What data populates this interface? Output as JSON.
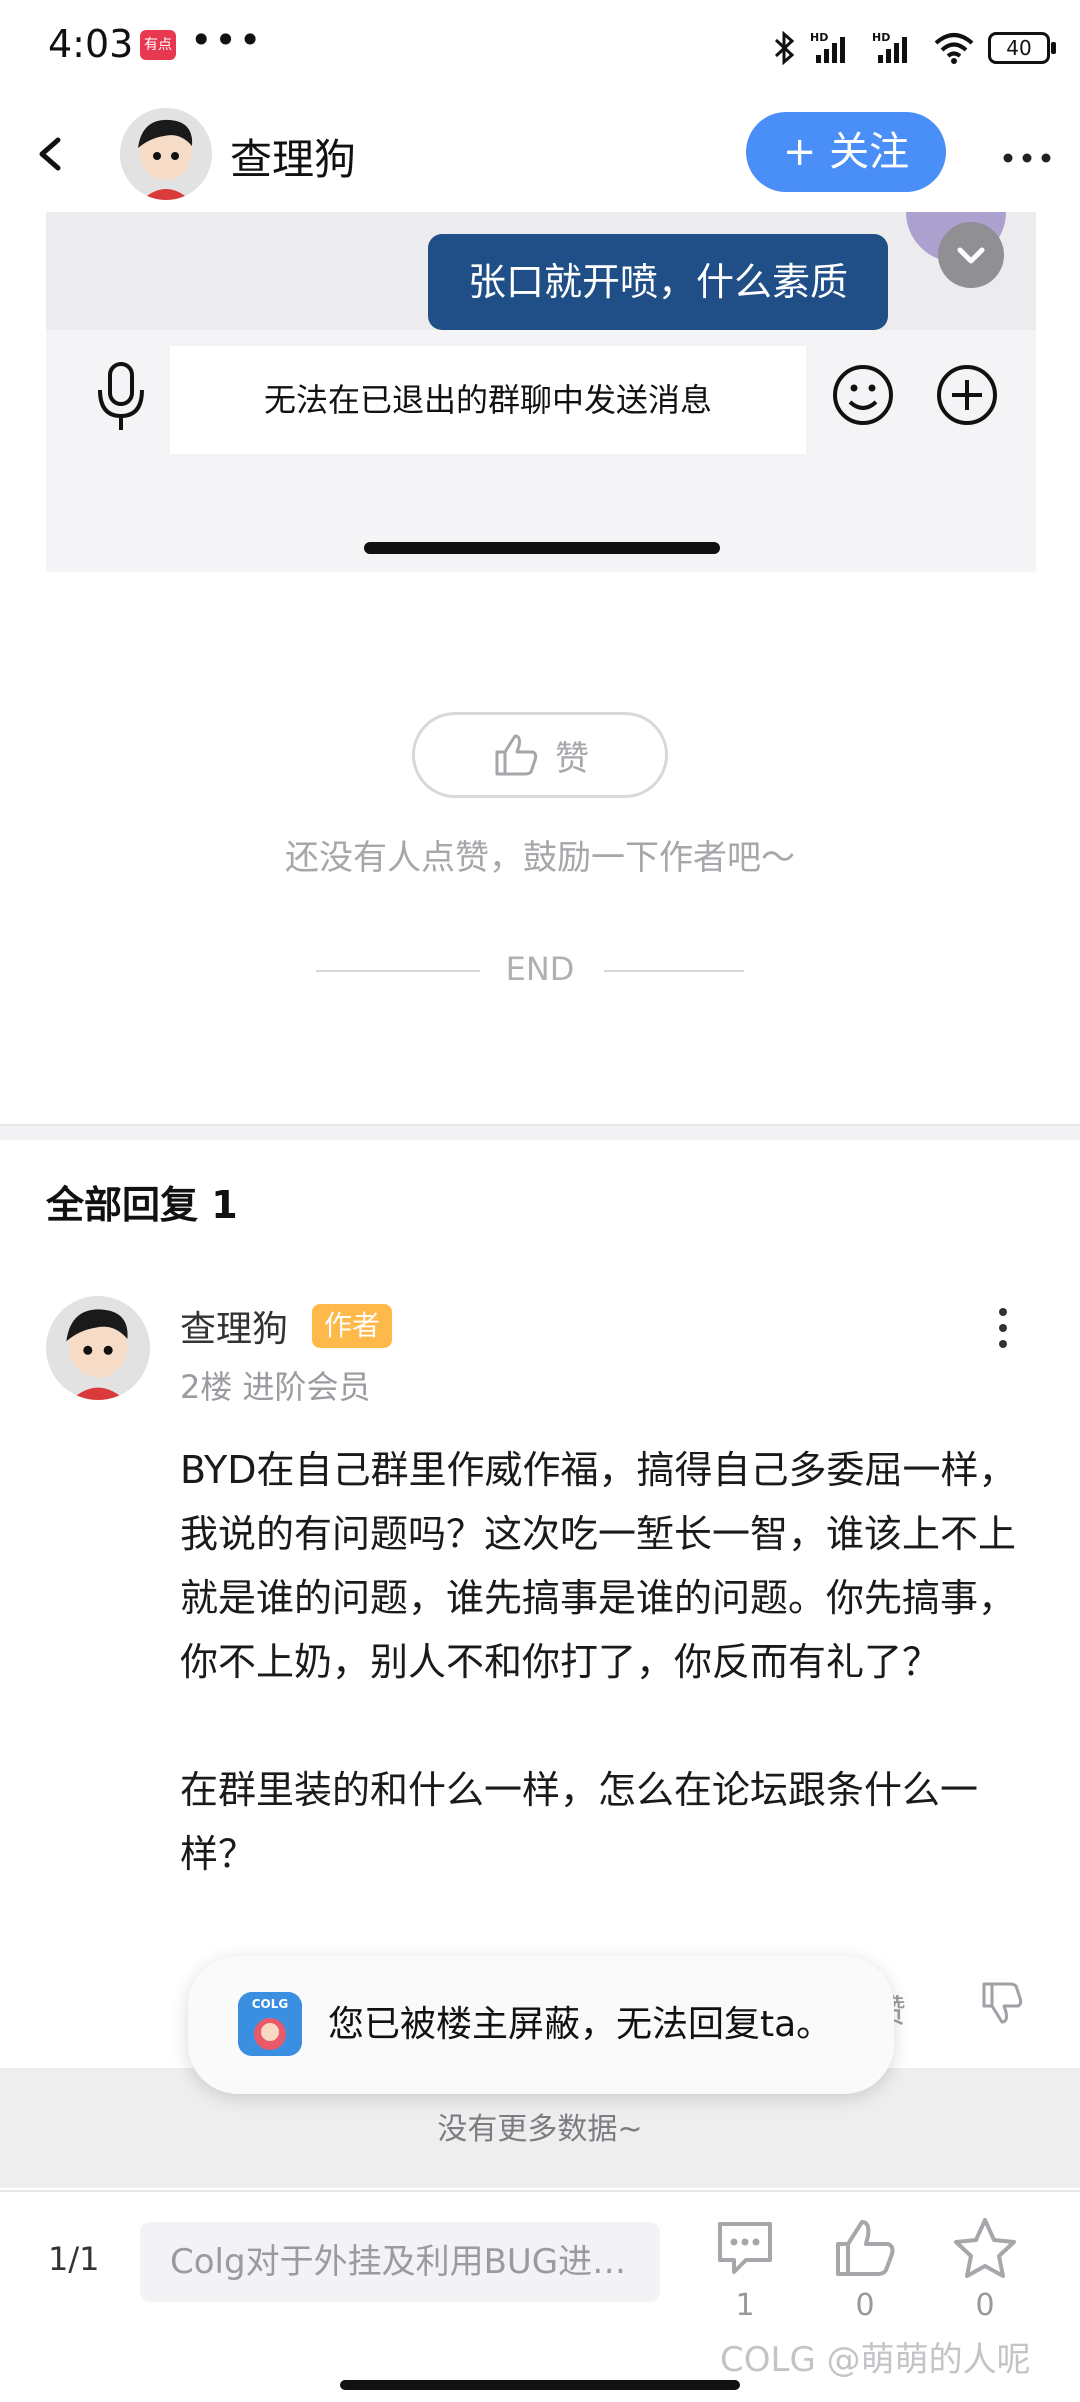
{
  "status_bar": {
    "time": "4:03",
    "app_badge": "有点",
    "dots": "•••",
    "battery": "40"
  },
  "header": {
    "title": "查理狗",
    "follow_label": "+ 关注"
  },
  "embedded_chat": {
    "bubble_text": "张口就开喷，什么素质",
    "input_text": "无法在已退出的群聊中发送消息"
  },
  "like": {
    "button_label": "赞",
    "hint": "还没有人点赞，鼓励一下作者吧～",
    "end": "END"
  },
  "replies": {
    "title": "全部回复 1",
    "items": [
      {
        "name": "查理狗",
        "badge": "作者",
        "meta": "2楼 进阶会员",
        "body": "BYD在自己群里作威作福，搞得自己多委屈一样，我说的有问题吗？这次吃一堑长一智，谁该上不上就是谁的问题，谁先搞事是谁的问题。你先搞事，你不上奶，别人不和你打了，你反而有礼了？\n\n在群里装的和什么一样，怎么在论坛跟条什么一样？",
        "like_label": "赞"
      }
    ]
  },
  "toast": {
    "text": "您已被楼主屏蔽，无法回复ta。",
    "icon_label": "COLG"
  },
  "no_more": "没有更多数据~",
  "bottom_bar": {
    "page": "1/1",
    "input_placeholder": "Colg对于外挂及利用BUG进…",
    "comment_count": "1",
    "like_count": "0",
    "favorite_count": "0",
    "watermark": "COLG @萌萌的人呢"
  },
  "colors": {
    "accent": "#4a8ef8",
    "badge": "#ffb84a",
    "bubble": "#1f4f86"
  },
  "icons": [
    "back-arrow-icon",
    "more-dots-icon",
    "mic-icon",
    "emoji-icon",
    "add-circle-icon",
    "thumbs-up-icon",
    "thumbs-down-icon",
    "comment-icon",
    "star-icon"
  ]
}
